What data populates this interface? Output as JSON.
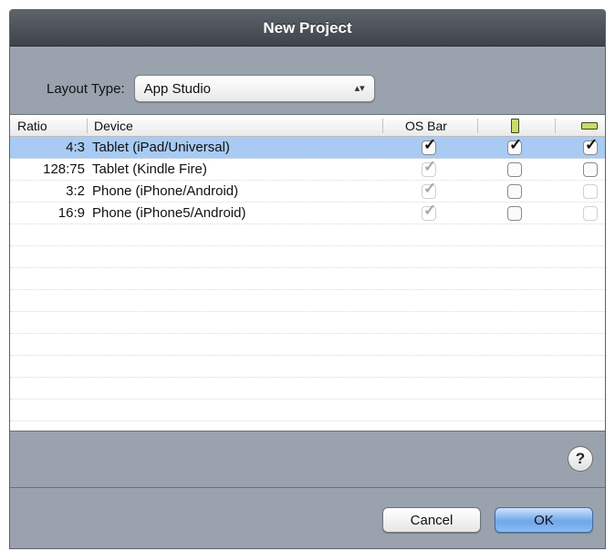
{
  "window": {
    "title": "New Project"
  },
  "layout": {
    "label": "Layout Type:",
    "selected": "App Studio",
    "arrows": "▴▾"
  },
  "table": {
    "headers": {
      "ratio": "Ratio",
      "device": "Device",
      "os_bar": "OS Bar"
    },
    "rows": [
      {
        "ratio": "4:3",
        "device": "Tablet (iPad/Universal)",
        "os_bar": "checked",
        "portrait": "checked",
        "landscape": "checked",
        "selected": true
      },
      {
        "ratio": "128:75",
        "device": "Tablet (Kindle Fire)",
        "os_bar": "checked-disabled",
        "portrait": "unchecked",
        "landscape": "unchecked",
        "selected": false
      },
      {
        "ratio": "3:2",
        "device": "Phone (iPhone/Android)",
        "os_bar": "checked-disabled",
        "portrait": "unchecked",
        "landscape": "disabled",
        "selected": false
      },
      {
        "ratio": "16:9",
        "device": "Phone (iPhone5/Android)",
        "os_bar": "checked-disabled",
        "portrait": "unchecked",
        "landscape": "disabled",
        "selected": false
      }
    ],
    "selection_color": "#a9cbf3"
  },
  "icons": {
    "help": "question-mark-icon",
    "portrait": "portrait-orientation-icon",
    "landscape": "landscape-orientation-icon",
    "check": "checkmark-icon"
  },
  "help": {
    "glyph": "?"
  },
  "buttons": {
    "cancel": "Cancel",
    "ok": "OK"
  }
}
